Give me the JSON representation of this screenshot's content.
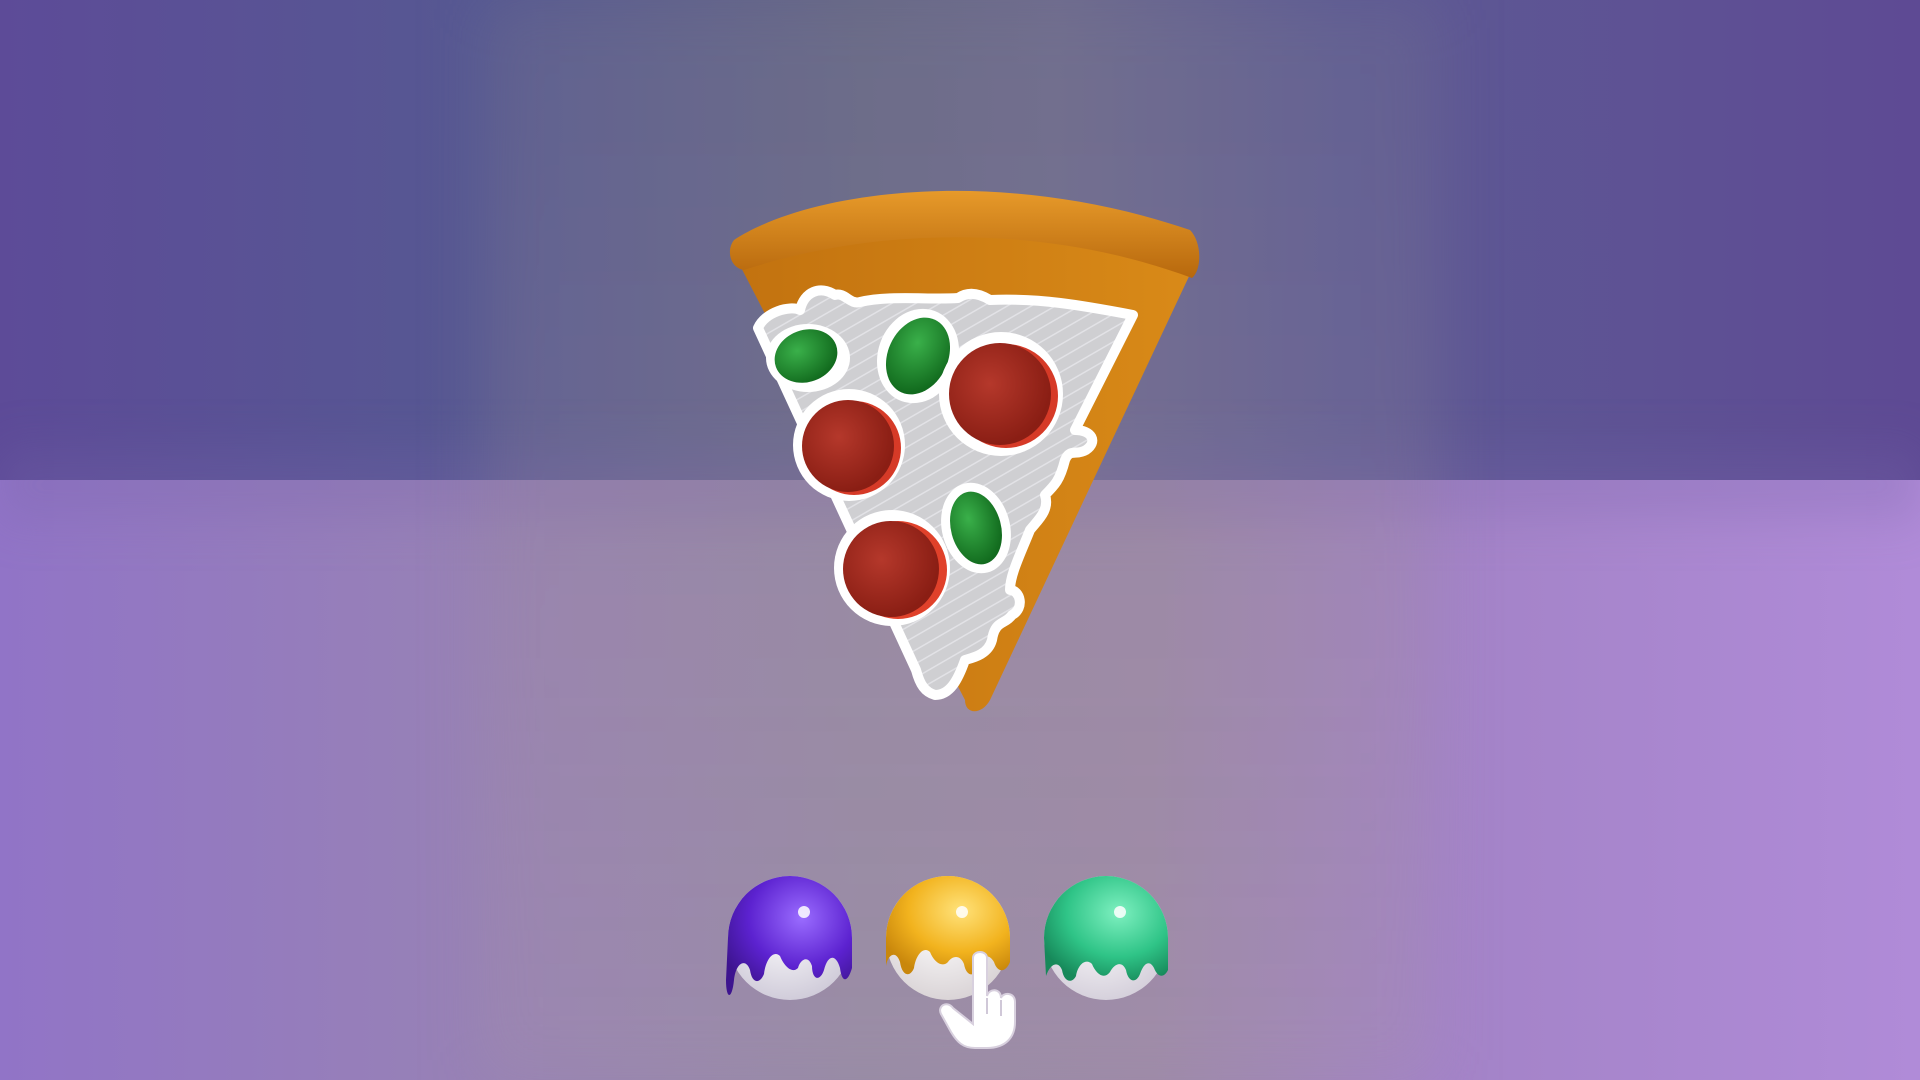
{
  "scene": {
    "title": "",
    "colors": {
      "background_top": "#5d4b98",
      "background_bottom": "#ab8bd8",
      "crust": "#d78a1c",
      "cheese_fill": "#cdcdcd",
      "outline": "#ffffff",
      "pepperoni": "#a0261b",
      "pepper": "#1f8a2c"
    }
  },
  "pizza": {
    "name": "pizza-slice",
    "toppings": [
      {
        "type": "green-pepper"
      },
      {
        "type": "green-pepper"
      },
      {
        "type": "pepperoni"
      },
      {
        "type": "pepperoni"
      },
      {
        "type": "green-pepper"
      },
      {
        "type": "pepperoni"
      }
    ]
  },
  "palette": {
    "balls": [
      {
        "name": "purple-paint-ball",
        "color": "#6a32d8"
      },
      {
        "name": "yellow-paint-ball",
        "color": "#f0b31e"
      },
      {
        "name": "green-paint-ball",
        "color": "#2fc487"
      }
    ],
    "cursor_icon": "pointing-hand-icon"
  }
}
